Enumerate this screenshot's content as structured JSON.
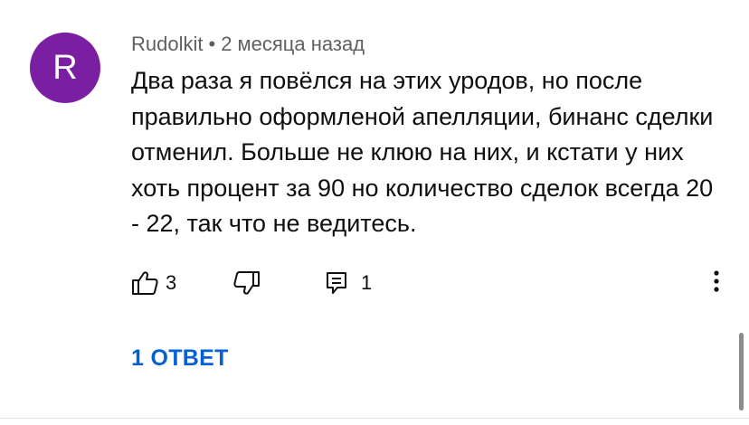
{
  "comment": {
    "avatar_letter": "R",
    "avatar_color": "#7b1fa2",
    "author": "Rudolkit",
    "separator": "•",
    "timestamp": "2 месяца назад",
    "text": "Два раза я повёлся на этих уродов, но после правильно оформленой апелляции, бинанс сделки отменил. Больше не клюю на них, и кстати у них хоть процент за 90 но количество сделок всегда 20 - 22, так что не ведитесь.",
    "likes": "3",
    "reply_count": "1",
    "replies_link": "1 ОТВЕТ",
    "icons": {
      "like": "thumbs-up-icon",
      "dislike": "thumbs-down-icon",
      "reply": "reply-comment-icon",
      "menu": "more-vertical-icon"
    }
  },
  "colors": {
    "link": "#065fd4",
    "meta_text": "#606060",
    "body_text": "#0f0f0f"
  }
}
